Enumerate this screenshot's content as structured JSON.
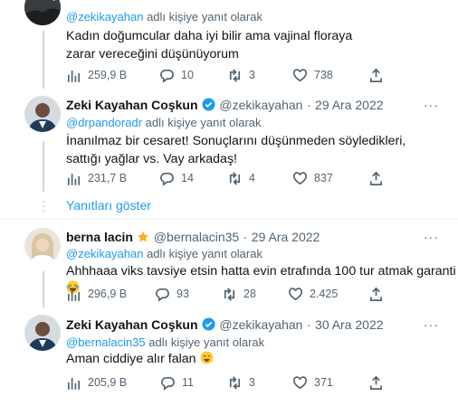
{
  "tweets": [
    {
      "reply_prefix": "@zekikayahan",
      "reply_suffix": " adlı kişiye yanıt olarak",
      "body": "Kadın doğumcular daha iyi bilir ama vajinal floraya zarar vereceğini düşünüyorum",
      "views": "259,9 B",
      "replies": "10",
      "retweets": "3",
      "likes": "738"
    },
    {
      "name": "Zeki Kayahan Coşkun",
      "handle": "@zekikayahan",
      "sep": "·",
      "date": "29 Ara 2022",
      "reply_prefix": "@drpandoradr",
      "reply_suffix": " adlı kişiye yanıt olarak",
      "body": "İnanılmaz bir cesaret! Sonuçlarını düşünmeden söyledikleri, sattığı yağlar vs. Vay arkadaş!",
      "views": "231,7 B",
      "replies": "14",
      "retweets": "4",
      "likes": "837"
    },
    {
      "name": "berna lacin",
      "handle": "@bernalacin35",
      "sep": "·",
      "date": "29 Ara 2022",
      "reply_prefix": "@zekikayahan",
      "reply_suffix": " adlı kişiye yanıt olarak",
      "body": "Ahhhaaa viks tavsiye etsin hatta evin etrafında 100 tur atmak garanti",
      "views": "296,9 B",
      "replies": "93",
      "retweets": "28",
      "likes": "2.425"
    },
    {
      "name": "Zeki Kayahan Coşkun",
      "handle": "@zekikayahan",
      "sep": "·",
      "date": "30 Ara 2022",
      "reply_prefix": "@bernalacin35",
      "reply_suffix": " adlı kişiye yanıt olarak",
      "body": "Aman ciddiye alır falan",
      "views": "205,9 B",
      "replies": "11",
      "retweets": "3",
      "likes": "371"
    }
  ],
  "show_replies_label": "Yanıtları göster",
  "more_label": "···",
  "colors": {
    "accent": "#1d9bf0",
    "muted": "#536471",
    "line": "#cfd9de",
    "star": "#ffad1f"
  }
}
